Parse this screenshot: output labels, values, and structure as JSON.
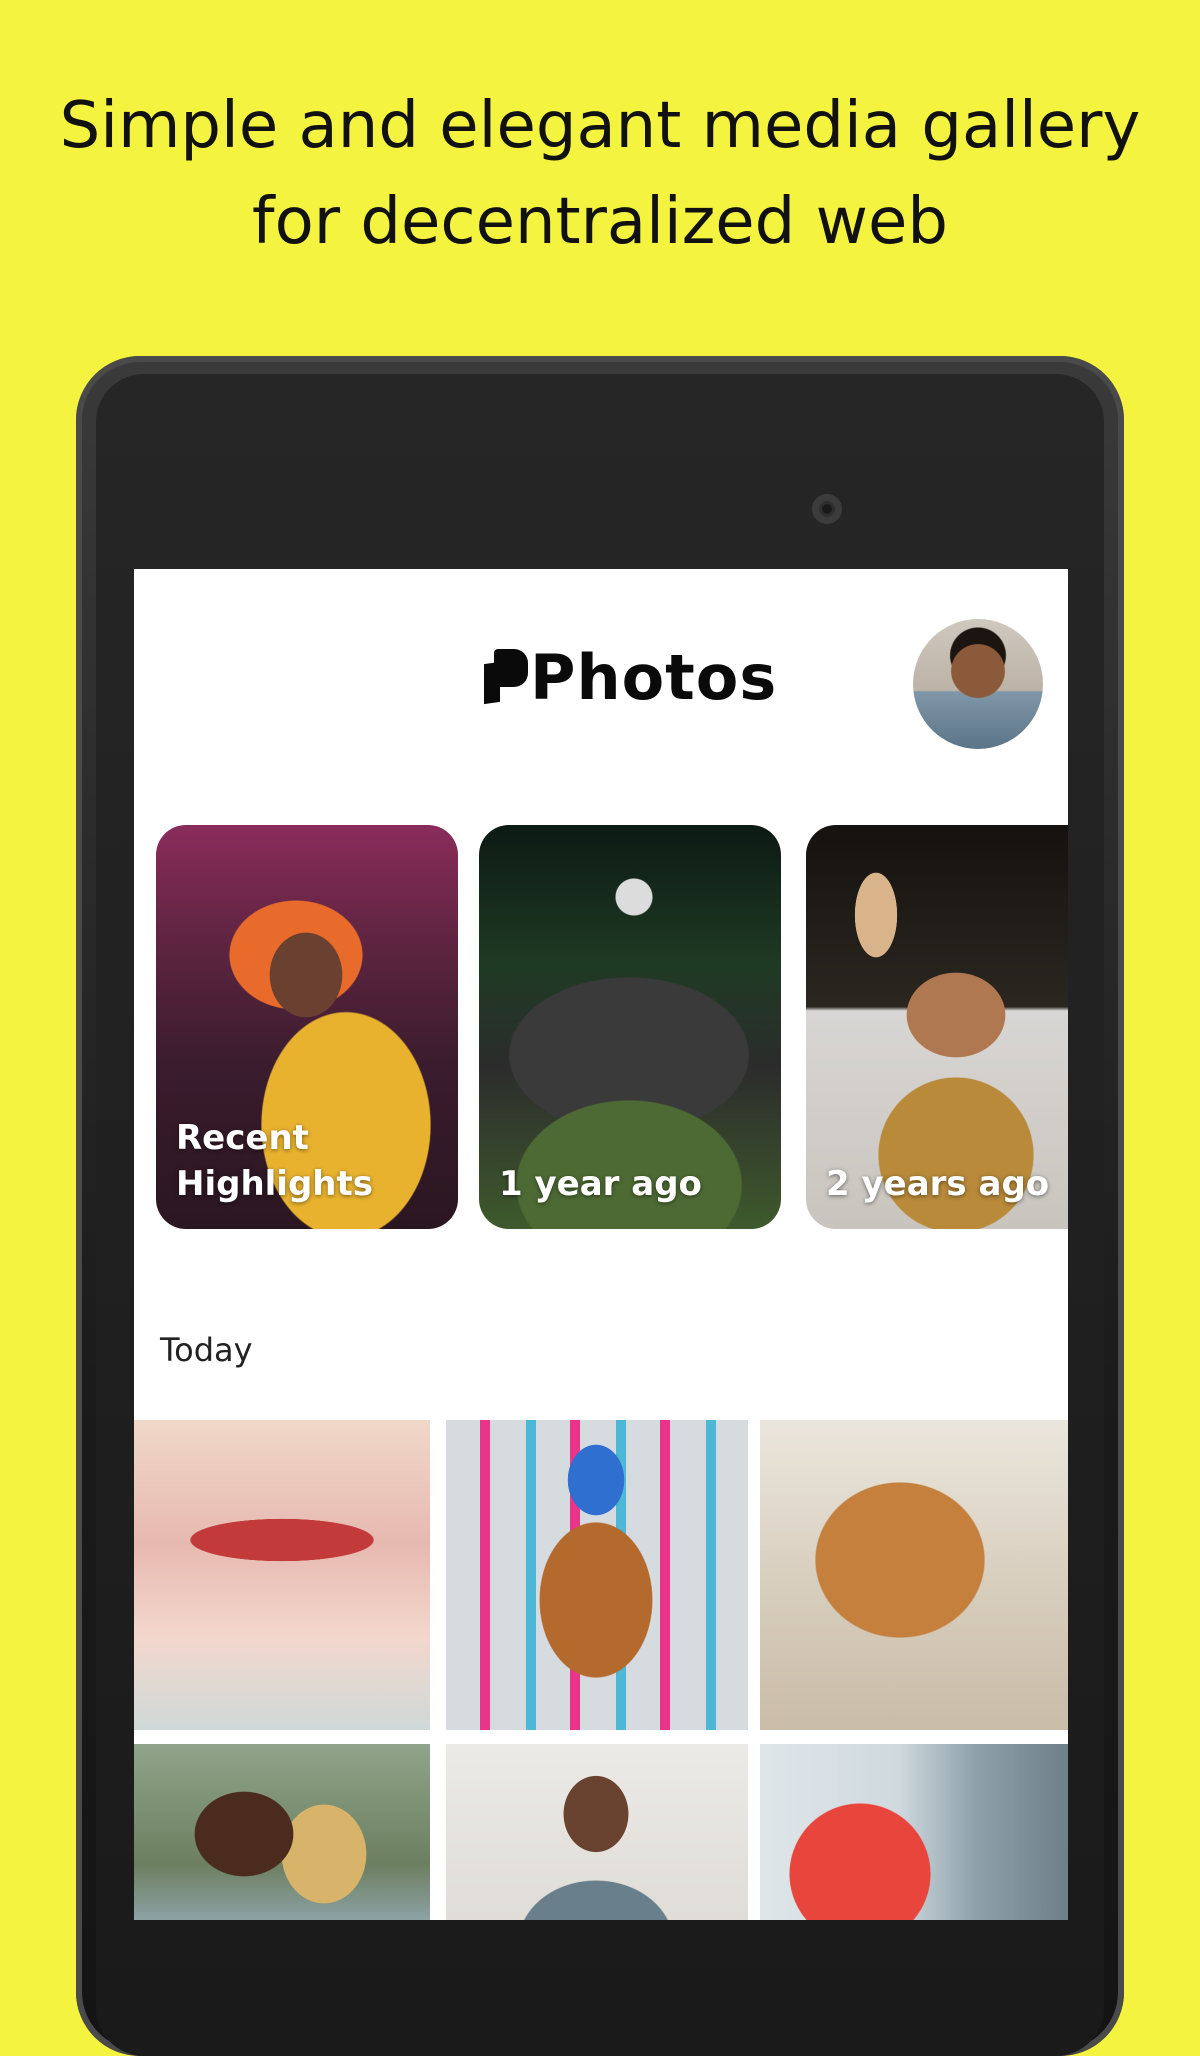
{
  "promo": {
    "headline_line1": "Simple and elegant media gallery",
    "headline_line2": "for decentralized web"
  },
  "app": {
    "title": "Photos",
    "avatar_icon": "user-avatar"
  },
  "highlights": [
    {
      "label_line1": "Recent",
      "label_line2": "Highlights"
    },
    {
      "label": "1 year ago"
    },
    {
      "label": "2 years ago"
    }
  ],
  "sections": [
    {
      "title": "Today",
      "photo_count_visible": 6
    }
  ],
  "colors": {
    "background": "#f4f33f",
    "tablet": "#1b1b1b",
    "screen": "#ffffff",
    "text": "#111111"
  }
}
